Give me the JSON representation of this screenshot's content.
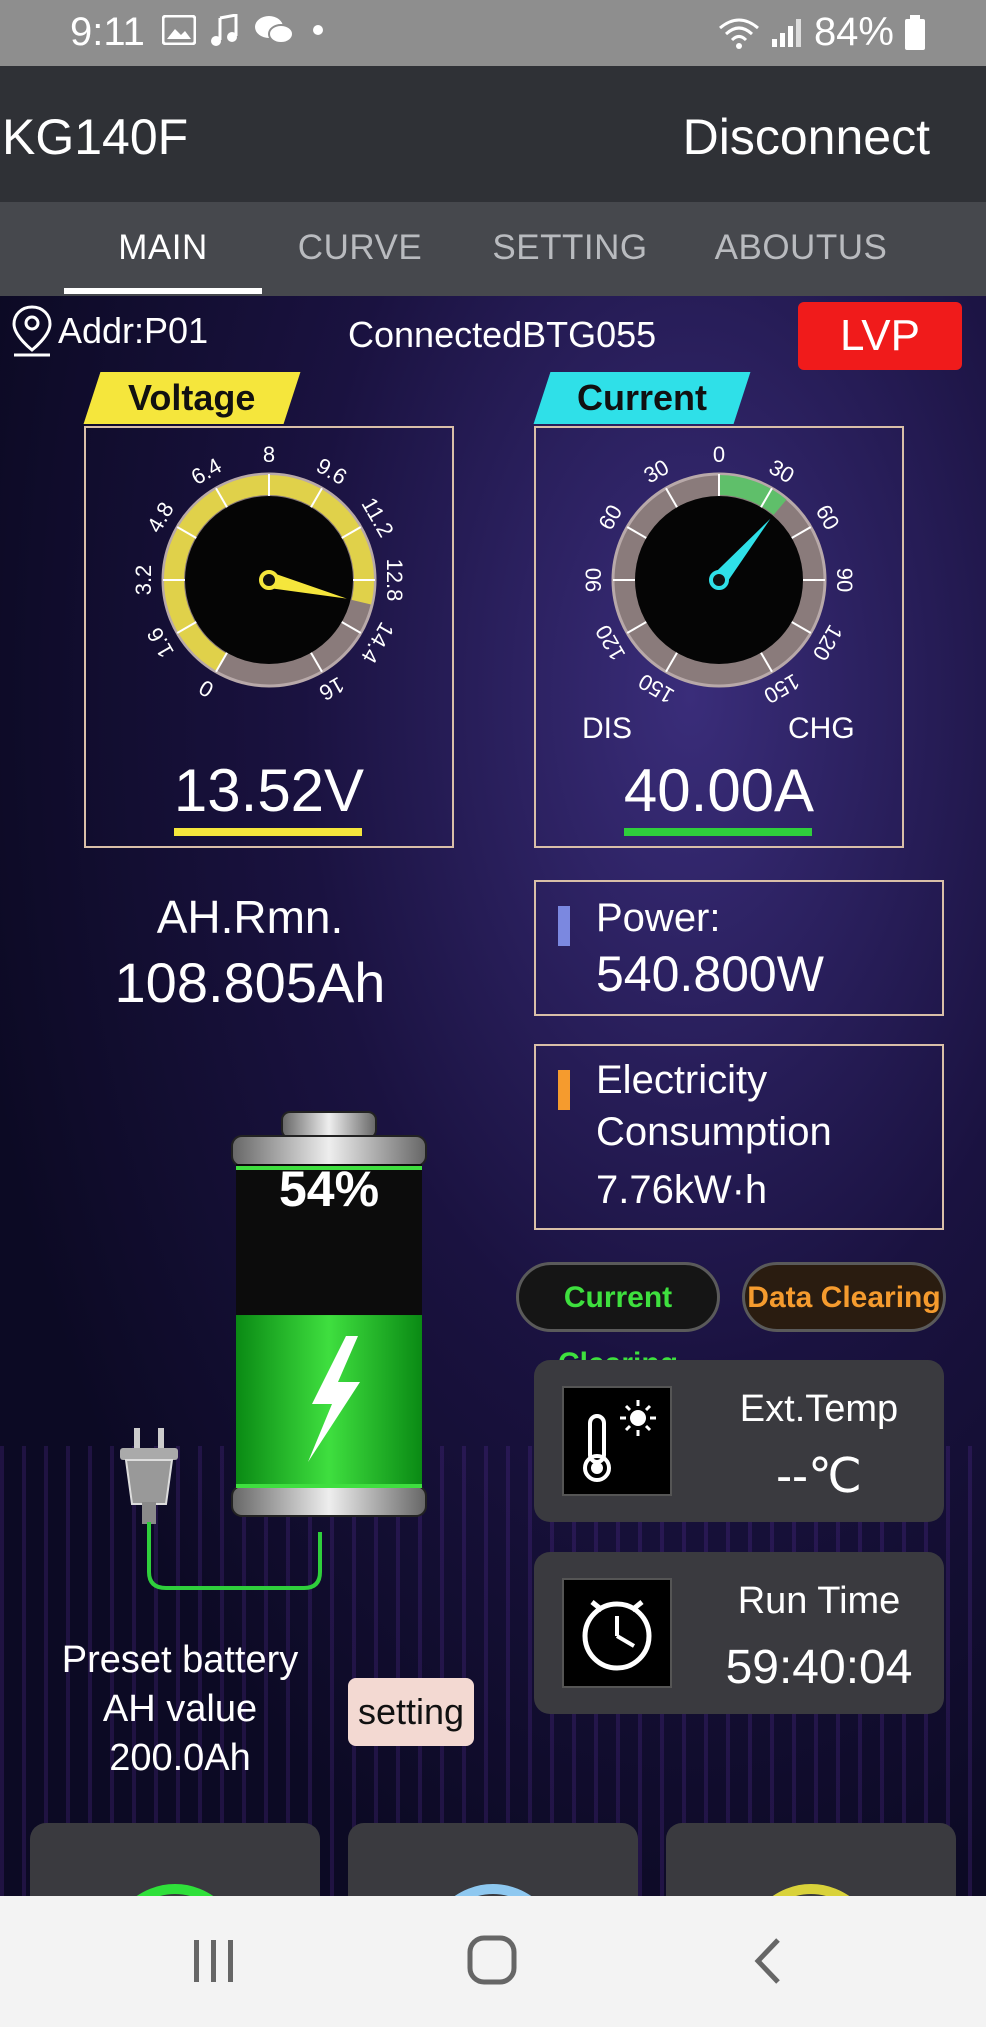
{
  "status_bar": {
    "time": "9:11",
    "battery": "84%"
  },
  "app_bar": {
    "title": "KG140F",
    "disconnect_label": "Disconnect"
  },
  "tabs": [
    {
      "label": "MAIN",
      "active": true
    },
    {
      "label": "CURVE",
      "active": false
    },
    {
      "label": "SETTING",
      "active": false
    },
    {
      "label": "ABOUTUS",
      "active": false
    }
  ],
  "device": {
    "addr": "Addr:P01",
    "connection": "ConnectedBTG055",
    "protection_badge": "LVP"
  },
  "voltage_gauge": {
    "label": "Voltage",
    "ticks": [
      "0",
      "1.6",
      "3.2",
      "4.8",
      "6.4",
      "8",
      "9.6",
      "11.2",
      "12.8",
      "14.4",
      "16"
    ],
    "value": "13.52V",
    "reading": 13.52,
    "label_color": "#f5e63c"
  },
  "current_gauge": {
    "label": "Current",
    "ticks_left": [
      "150",
      "120",
      "90",
      "60",
      "30"
    ],
    "center_tick": "0",
    "ticks_right": [
      "30",
      "60",
      "90",
      "120",
      "150"
    ],
    "dis_label": "DIS",
    "chg_label": "CHG",
    "value": "40.00A",
    "reading": 40.0,
    "label_color": "#2fe0e8"
  },
  "ah_remaining": {
    "label": "AH.Rmn.",
    "value": "108.805Ah"
  },
  "power": {
    "label": "Power:",
    "value": "540.800W"
  },
  "consumption": {
    "label_line1": "Electricity",
    "label_line2": "Consumption",
    "value": "7.76kW·h"
  },
  "battery": {
    "percent_label": "54%",
    "percent": 0.54
  },
  "buttons": {
    "current_clearing": "Current Clearing",
    "data_clearing": "Data Clearing",
    "setting": "setting"
  },
  "ext_temp": {
    "label": "Ext.Temp",
    "value": "--℃"
  },
  "run_time": {
    "label": "Run Time",
    "value": "59:40:04"
  },
  "preset": {
    "line1": "Preset battery",
    "line2": "AH value",
    "line3": "200.0Ah"
  },
  "colors": {
    "power_marker": "#7b88e0",
    "consumption_marker": "#f59b2e",
    "battery_green": "#22c322",
    "lvp": "#f01b1b"
  }
}
